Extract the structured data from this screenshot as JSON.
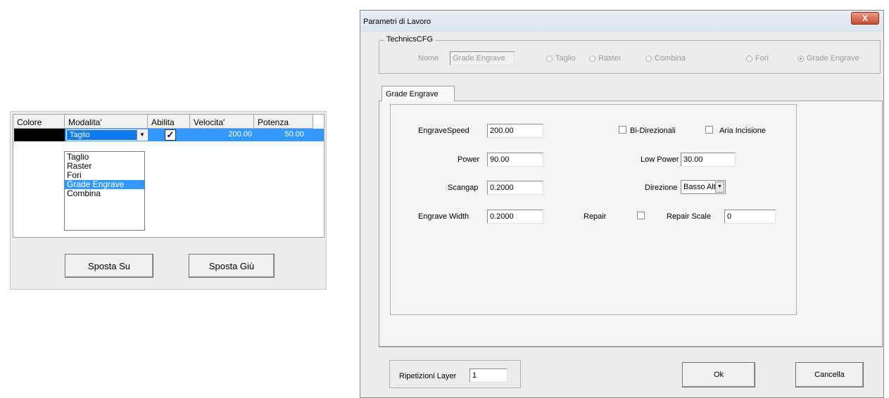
{
  "layers": {
    "columns": [
      "Colore",
      "Modalita'",
      "Abilita",
      "Velocita'",
      "Potenza"
    ],
    "row": {
      "color": "#000000",
      "mode": "Taglio",
      "enabled": true,
      "speed": "200.00",
      "power": "50.00"
    },
    "dropdown_options": [
      "Taglio",
      "Raster",
      "Fori",
      "Grade Engrave",
      "Combina"
    ],
    "dropdown_selected": "Grade Engrave",
    "move_up_label": "Sposta Su",
    "move_down_label": "Sposta Giù"
  },
  "dialog": {
    "title": "Parametri di Lavoro",
    "close_glyph": "X",
    "technics": {
      "legend": "TechnicsCFG",
      "name_label": "Nome",
      "name_value": "Grade Engrave",
      "options": [
        "Taglio",
        "Raster",
        "Combina",
        "Fori",
        "Grade Engrave"
      ],
      "selected": "Grade Engrave"
    },
    "tab_label": "Grade Engrave",
    "fields": {
      "engrave_speed_label": "EngraveSpeed",
      "engrave_speed": "200.00",
      "power_label": "Power",
      "power": "90.00",
      "scangap_label": "Scangap",
      "scangap": "0.2000",
      "engrave_width_label": "Engrave Width",
      "engrave_width": "0.2000",
      "bidir_label": "Bi-Direzionali",
      "bidir_checked": false,
      "aria_label": "Aria Incisione",
      "aria_checked": false,
      "low_power_label": "Low Power",
      "low_power": "30.00",
      "direzione_label": "Direzione",
      "direzione": "Basso Alto",
      "repair_label": "Repair",
      "repair_checked": false,
      "repair_scale_label": "Repair Scale",
      "repair_scale": "0"
    },
    "ripetizioni_label": "Ripetizioni Layer",
    "ripetizioni": "1",
    "ok_label": "Ok",
    "cancel_label": "Cancella"
  }
}
